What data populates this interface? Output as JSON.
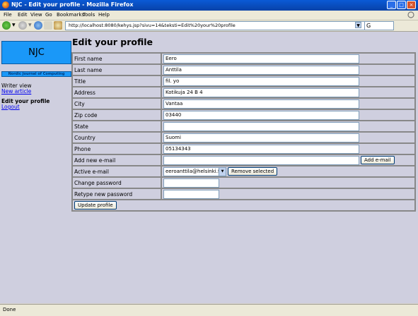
{
  "window": {
    "title": "NJC - Edit your profile - Mozilla Firefox"
  },
  "menu": [
    "File",
    "Edit",
    "View",
    "Go",
    "Bookmarks",
    "Tools",
    "Help"
  ],
  "url": "http://localhost:8080/kehys.jsp?sivu=14&teksti=Edit%20your%20profile",
  "sidebar": {
    "logo": "NJC",
    "journal": "Nordic Journal of Computing",
    "view_label": "Writer view",
    "new_article": "New article",
    "edit_profile": "Edit your profile",
    "logout": "Logout"
  },
  "page": {
    "heading": "Edit your profile"
  },
  "form": {
    "first_name_label": "First name",
    "first_name": "Eero",
    "last_name_label": "Last name",
    "last_name": "Anttila",
    "title_label": "Title",
    "title": "fil. yo",
    "address_label": "Address",
    "address": "Kotikuja 24 B 4",
    "city_label": "City",
    "city": "Vantaa",
    "zip_label": "Zip code",
    "zip": "03440",
    "state_label": "State",
    "state": "",
    "country_label": "Country",
    "country": "Suomi",
    "phone_label": "Phone",
    "phone": "05134343",
    "add_email_label": "Add new e-mail",
    "add_email": "",
    "add_email_button": "Add e-mail",
    "active_email_label": "Active e-mail",
    "active_email": "eeroanttila@helsinki.fi",
    "remove_button": "Remove selected",
    "change_password_label": "Change password",
    "retype_password_label": "Retype new password",
    "update_button": "Update profile"
  },
  "status": {
    "text": "Done"
  }
}
